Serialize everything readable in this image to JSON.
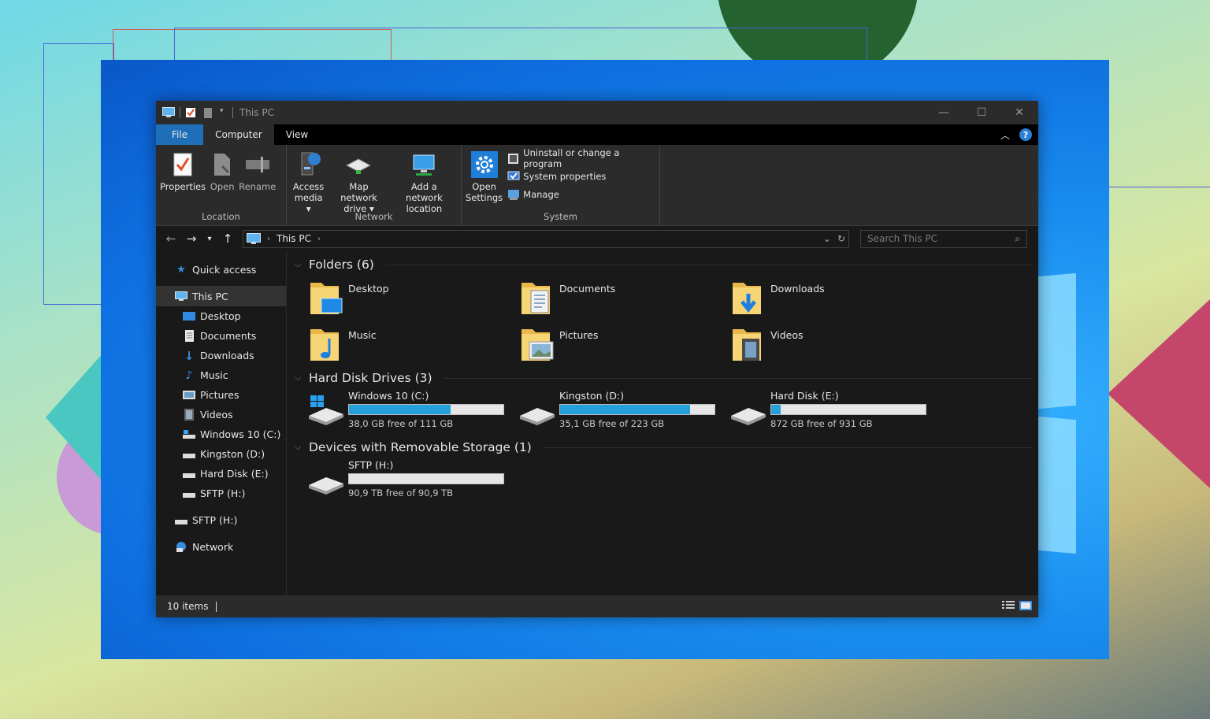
{
  "titlebar": {
    "title": "This PC",
    "controls": {
      "minimize": "—",
      "maximize": "☐",
      "close": "✕"
    }
  },
  "ribbon_tabs": {
    "file": "File",
    "computer": "Computer",
    "view": "View"
  },
  "ribbon": {
    "location": {
      "label": "Location",
      "properties": "Properties",
      "open": "Open",
      "rename": "Rename"
    },
    "network": {
      "label": "Network",
      "access_media_1": "Access",
      "access_media_2": "media ▾",
      "map_drive_1": "Map network",
      "map_drive_2": "drive ▾",
      "add_location_1": "Add a network",
      "add_location_2": "location"
    },
    "system": {
      "label": "System",
      "open_settings_1": "Open",
      "open_settings_2": "Settings",
      "uninstall": "Uninstall or change a program",
      "system_properties": "System properties",
      "manage": "Manage"
    }
  },
  "address": {
    "location": "This PC"
  },
  "search": {
    "placeholder": "Search This PC"
  },
  "sidebar": {
    "quick_access": "Quick access",
    "this_pc": "This PC",
    "children": [
      "Desktop",
      "Documents",
      "Downloads",
      "Music",
      "Pictures",
      "Videos",
      "Windows 10 (C:)",
      "Kingston (D:)",
      "Hard Disk (E:)",
      "SFTP (H:)"
    ],
    "sftp": "SFTP (H:)",
    "network": "Network"
  },
  "sections": {
    "folders": "Folders (6)",
    "drives": "Hard Disk Drives (3)",
    "removable": "Devices with Removable Storage (1)"
  },
  "folders": [
    "Desktop",
    "Documents",
    "Downloads",
    "Music",
    "Pictures",
    "Videos"
  ],
  "drives": [
    {
      "name": "Windows 10 (C:)",
      "free": "38,0 GB free of 111 GB",
      "used_fraction": 0.66
    },
    {
      "name": "Kingston (D:)",
      "free": "35,1 GB free of 223 GB",
      "used_fraction": 0.84
    },
    {
      "name": "Hard Disk (E:)",
      "free": "872 GB free of 931 GB",
      "used_fraction": 0.06
    }
  ],
  "removable": [
    {
      "name": "SFTP (H:)",
      "free": "90,9 TB free of 90,9 TB",
      "used_fraction": 0.0
    }
  ],
  "status": {
    "items": "10 items"
  },
  "colors": {
    "accent": "#1f6fb8",
    "drive_fill": "#26a0da",
    "window_bg": "#191919",
    "ribbon_bg": "#2b2b2b"
  }
}
